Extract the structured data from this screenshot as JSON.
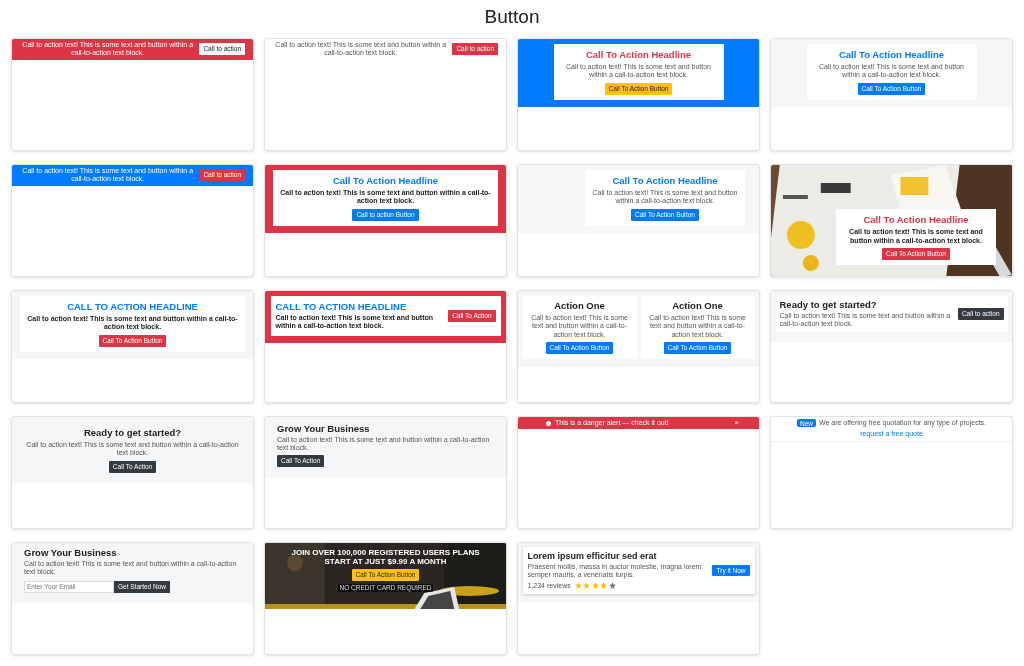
{
  "title": "Button",
  "cards": [
    {
      "kind": "bar",
      "color": "#dc3545",
      "text": "Call to action text! This is some text and button within a call-to-action text block.",
      "button": {
        "label": "Call to action",
        "color": "#f8f9fa"
      }
    },
    {
      "kind": "bar",
      "color": "#ffffff",
      "text": "Call to action text! This is some text and button within a call-to-action text block.",
      "button": {
        "label": "Call to action",
        "color": "#dc3545"
      }
    },
    {
      "kind": "centered-box",
      "color": "#007bff",
      "headline": {
        "text": "Call To Action Headline",
        "color": "#dc3545"
      },
      "bold_text": false,
      "text": "Call to action text! This is some text and button within a call-to-action text block.",
      "button": {
        "label": "Call To Action Button",
        "color": "#ffc107"
      }
    },
    {
      "kind": "centered-box",
      "color": "#f5f6f8",
      "headline": {
        "text": "Call To Action Headline",
        "color": "#007bff"
      },
      "bold_text": false,
      "text": "Call to action text! This is some text and button within a call-to-action text block.",
      "button": {
        "label": "Call To Action Button",
        "color": "#007bff"
      }
    },
    {
      "kind": "bar",
      "color": "#007bff",
      "text": "Call to action text! This is some text and button within a call-to-action text block.",
      "button": {
        "label": "Call to action",
        "color": "#dc3545"
      }
    },
    {
      "kind": "wide-box",
      "color": "#dc3545",
      "headline": {
        "text": "Call To Action Headline",
        "color": "#007bff"
      },
      "bold_text": true,
      "text": "Call to action text! This is some text and button within a call-to-action text block.",
      "button": {
        "label": "Call to action Button",
        "color": "#007bff"
      }
    },
    {
      "kind": "right-box",
      "color": "#f5f6f8",
      "headline": {
        "text": "Call To Action Headline",
        "color": "#007bff"
      },
      "bold_text": false,
      "text": "Call to action text! This is some text and button within a call-to-action text block.",
      "button": {
        "label": "Call To Action Button",
        "color": "#007bff"
      }
    },
    {
      "headline": {
        "text": "Call To Action Headline",
        "color": "#dc3545"
      },
      "text": "Call to action text! This is some text and button within a call-to-action text block.",
      "button": {
        "label": "Call To Action Button",
        "color": "#dc3545"
      }
    },
    {
      "kind": "wide-box",
      "color": "#f5f6f8",
      "headline": {
        "text": "CALL TO ACTION HEADLINE",
        "color": "#007bff"
      },
      "bold_text": true,
      "text": "Call to action text! This is some text and button within a call-to-action text block.",
      "button": {
        "label": "Call To Action Button",
        "color": "#dc3545"
      }
    },
    {
      "kind": "inline-panel",
      "color": "#dc3545",
      "headline": {
        "text": "CALL TO ACTION HEADLINE",
        "color": "#007bff"
      },
      "text": "Call to action text! This is some text and button within a call-to-action text block.",
      "button": {
        "label": "Call To Action",
        "color": "#dc3545"
      }
    },
    {
      "kind": "two-col",
      "color": "#f5f6f8",
      "boxes": [
        {
          "headline": "Action One",
          "text": "Call to action text! This is some text and button within a call-to-action text block.",
          "button": {
            "label": "Call To Action Button",
            "color": "#007bff"
          }
        },
        {
          "headline": "Action One",
          "text": "Call to action text! This is some text and button within a call-to-action text block.",
          "button": {
            "label": "Call To Action Button",
            "color": "#007bff"
          }
        }
      ]
    },
    {
      "kind": "strip",
      "color": "#f5f6f8",
      "headline": "Ready to get started?",
      "text": "Call to action text! This is some text and button within a call-to-action text block.",
      "button": {
        "label": "Call to action",
        "color": "#343a40"
      }
    },
    {
      "kind": "centered",
      "color": "#f5f6f8",
      "headline": "Ready to get started?",
      "text": "Call to action text! This is some text and button within a call-to-action text block.",
      "button": {
        "label": "Call To Action",
        "color": "#343a40"
      }
    },
    {
      "kind": "left",
      "color": "#f5f6f8",
      "headline": "Grow Your Business",
      "text": "Call to action text! This is some text and button within a call-to-action text block.",
      "button": {
        "label": "Call To Action",
        "color": "#343a40"
      }
    },
    {
      "kind": "alert",
      "color": "#dc3545",
      "text": "This is a danger alert — check it out!",
      "close": "×"
    },
    {
      "kind": "notice",
      "badge": "New",
      "text": "We are offering free quotation for any type of projects.",
      "link": "request a free quote"
    },
    {
      "kind": "form",
      "color": "#f5f6f8",
      "headline": "Grow Your Business",
      "text": "Call to action text! This is some text and button within a call-to-action text block.",
      "placeholder": "Enter Your Email",
      "button": {
        "label": "Get Started Now",
        "color": "#343a40"
      }
    },
    {
      "kind": "hero",
      "headline": "JOIN OVER 100,000 REGISTERED USERS PLANS START AT JUST $9.99 A MONTH",
      "button": {
        "label": "Call To Action Button",
        "color": "#ffc107"
      },
      "note": "NO CREDIT CARD REQUIRED"
    },
    {
      "kind": "review",
      "color": "#f5f6f8",
      "headline": "Lorem ipsum efficitur sed erat",
      "text": "Praesent mollis, massa in auctor molestie, magna lorem semper mauris, a venenatis turpis.",
      "reviews": "1,234 reviews",
      "stars": 4,
      "button": {
        "label": "Try it Now",
        "color": "#007bff"
      }
    }
  ]
}
